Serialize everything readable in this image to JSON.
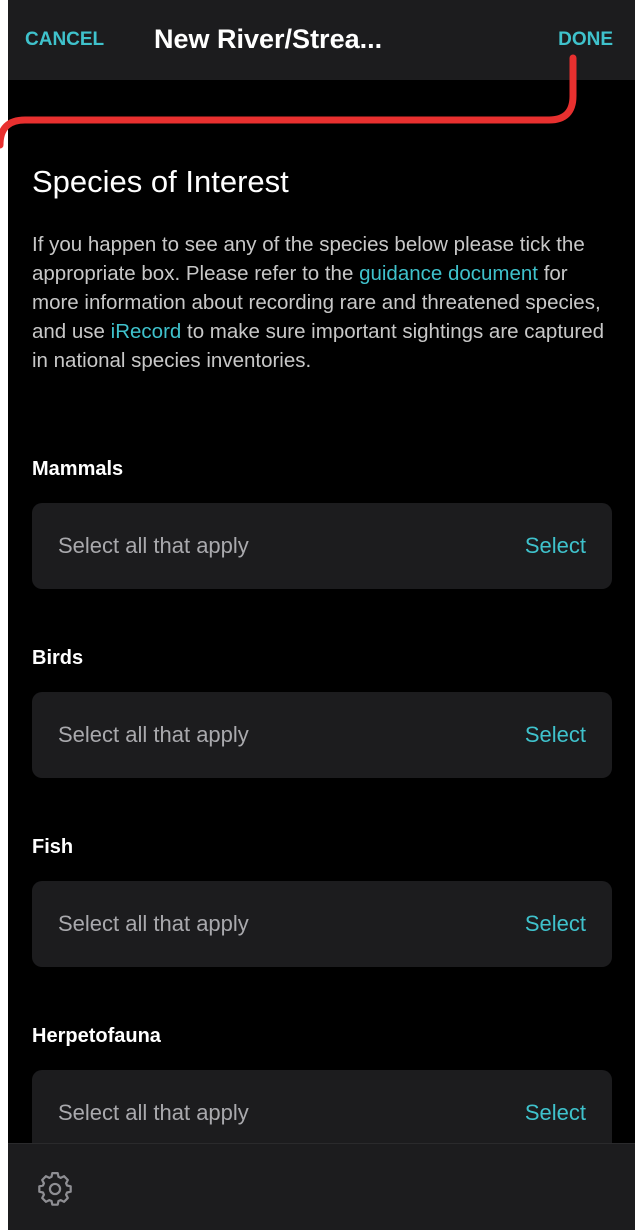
{
  "header": {
    "cancel_label": "CANCEL",
    "title": "New River/Strea...",
    "done_label": "DONE"
  },
  "intro": {
    "title": "Species of Interest",
    "text_part1": "If you happen to see any of the species below please tick the appropriate box. Please refer to the ",
    "link_guidance": "guidance document",
    "text_part2": " for more information about recording rare and threatened species, and use ",
    "link_irecord": "iRecord",
    "text_part3": " to make sure important sightings are captured in national species inventories."
  },
  "groups": [
    {
      "label": "Mammals",
      "placeholder": "Select all that apply",
      "action": "Select"
    },
    {
      "label": "Birds",
      "placeholder": "Select all that apply",
      "action": "Select"
    },
    {
      "label": "Fish",
      "placeholder": "Select all that apply",
      "action": "Select"
    },
    {
      "label": "Herpetofauna",
      "placeholder": "Select all that apply",
      "action": "Select"
    }
  ],
  "footer": {
    "settings_icon": "gear-icon"
  },
  "colors": {
    "accent": "#3fc2cc",
    "background": "#000000",
    "surface": "#1c1c1e",
    "annotation_arrow": "#e8302f"
  }
}
